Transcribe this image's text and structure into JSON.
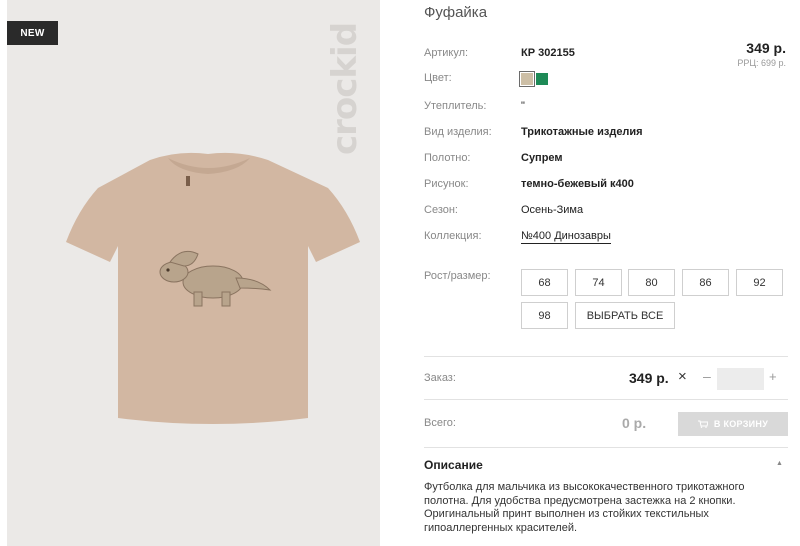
{
  "badge": "NEW",
  "brand": "crockid",
  "product": {
    "title": "Фуфайка",
    "price": "349 р.",
    "rrc": "РРЦ: 699 р."
  },
  "props": {
    "article_label": "Артикул:",
    "article_value": "КР 302155",
    "color_label": "Цвет:",
    "insulation_label": "Утеплитель:",
    "insulation_value": "\"",
    "type_label": "Вид изделия:",
    "type_value": "Трикотажные изделия",
    "fabric_label": "Полотно:",
    "fabric_value": "Супрем",
    "print_label": "Рисунок:",
    "print_value": "темно-бежевый к400",
    "season_label": "Сезон:",
    "season_value": "Осень-Зима",
    "collection_label": "Коллекция:",
    "collection_value": "№400 Динозавры"
  },
  "colors": [
    "#cdbfa6",
    "#1e8a57"
  ],
  "sizes": {
    "label": "Рост/размер:",
    "items": [
      "68",
      "74",
      "80",
      "86",
      "92",
      "98"
    ],
    "select_all": "ВЫБРАТЬ ВСЕ"
  },
  "order": {
    "label": "Заказ:",
    "price": "349 р.",
    "multiply": "×",
    "minus": "–",
    "plus": "+",
    "qty": ""
  },
  "total": {
    "label": "Всего:",
    "value": "0 р.",
    "cart_button": "В КОРЗИНУ"
  },
  "description": {
    "title": "Описание",
    "toggle": "▲",
    "text": "Футболка для мальчика из высококачественного трикотажного полотна. Для удобства предусмотрена застежка на 2 кнопки. Оригинальный принт выполнен из стойких текстильных гипоаллергенных красителей."
  }
}
